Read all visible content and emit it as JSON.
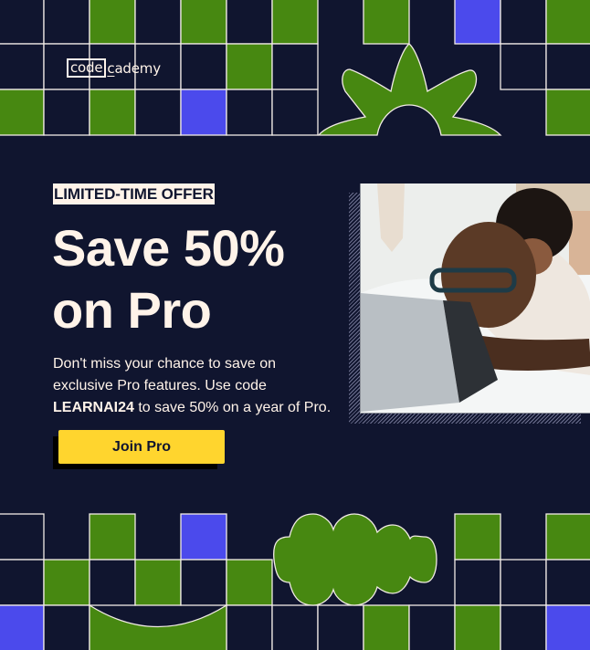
{
  "brand": {
    "logo_boxed": "code",
    "logo_rest_prefix": "c",
    "logo_rest": "ademy"
  },
  "colors": {
    "background": "#10152f",
    "green": "#478811",
    "blue": "#4b4aec",
    "cream": "#fff3e9",
    "cta_yellow": "#ffd52e"
  },
  "offer": {
    "badge": "LIMITED-TIME OFFER",
    "headline_line1": "Save 50%",
    "headline_line2": "on Pro",
    "body_line1": "Don't miss your chance to save on",
    "body_line2": "exclusive Pro features. Use code",
    "promo_code": "LEARNAI24",
    "body_line3_rest": " to save 50% on a year of Pro.",
    "cta_label": "Join Pro"
  },
  "hero_image": {
    "alt": "Man wearing glasses typing on a laptop in bed with a child leaning on his back"
  },
  "decor": {
    "top_grid": [
      [
        "outline",
        "outline",
        "green",
        "outline",
        "green",
        "outline",
        "green",
        "none",
        "green",
        "none",
        "blue",
        "outline",
        "green"
      ],
      [
        "outline",
        "outline",
        "outline",
        "outline",
        "outline",
        "green",
        "outline",
        "none",
        "none",
        "none",
        "none",
        "outline",
        "outline"
      ],
      [
        "green",
        "outline",
        "green",
        "outline",
        "blue",
        "outline",
        "outline",
        "none",
        "none",
        "none",
        "none",
        "none",
        "green"
      ]
    ],
    "bottom_grid": [
      [
        "outline",
        "none",
        "green",
        "none",
        "blue",
        "none",
        "none",
        "none",
        "none",
        "none",
        "green",
        "none",
        "green"
      ],
      [
        "outline",
        "green",
        "outline",
        "green",
        "outline",
        "green",
        "none",
        "none",
        "none",
        "none",
        "outline",
        "outline",
        "outline"
      ],
      [
        "blue",
        "outline",
        "arch",
        "arch",
        "arch",
        "outline",
        "outline",
        "outline",
        "green",
        "outline",
        "green",
        "outline",
        "blue"
      ]
    ]
  }
}
